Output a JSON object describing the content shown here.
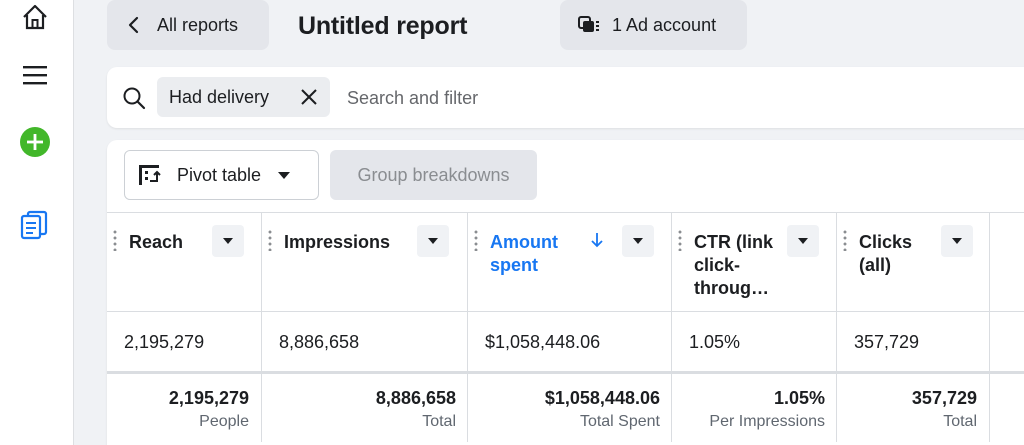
{
  "topbar": {
    "back_label": "All reports",
    "report_title": "Untitled report",
    "account_label": "1 Ad account"
  },
  "rail": {
    "icons": [
      "home-icon",
      "menu-icon",
      "create-icon",
      "reports-icon"
    ],
    "create_color": "#42b72a",
    "reports_color": "#1877f2"
  },
  "filter": {
    "chip_label": "Had delivery",
    "placeholder": "Search and filter"
  },
  "toolbar": {
    "pivot_label": "Pivot table",
    "group_label": "Group breakdowns"
  },
  "table": {
    "columns": [
      {
        "label": "Reach",
        "sorted": false
      },
      {
        "label": "Impressions",
        "sorted": false
      },
      {
        "label": "Amount spent",
        "sorted": true,
        "sort_direction": "descending"
      },
      {
        "label": "CTR (link click-throug…",
        "sorted": false
      },
      {
        "label": "Clicks (all)",
        "sorted": false
      }
    ],
    "row": [
      "2,195,279",
      "8,886,658",
      "$1,058,448.06",
      "1.05%",
      "357,729"
    ],
    "totals": [
      {
        "value": "2,195,279",
        "sub": "People"
      },
      {
        "value": "8,886,658",
        "sub": "Total"
      },
      {
        "value": "$1,058,448.06",
        "sub": "Total Spent"
      },
      {
        "value": "1.05%",
        "sub": "Per Impressions"
      },
      {
        "value": "357,729",
        "sub": "Total"
      }
    ]
  },
  "colors": {
    "accent": "#1877f2",
    "background": "#f0f2f5"
  }
}
